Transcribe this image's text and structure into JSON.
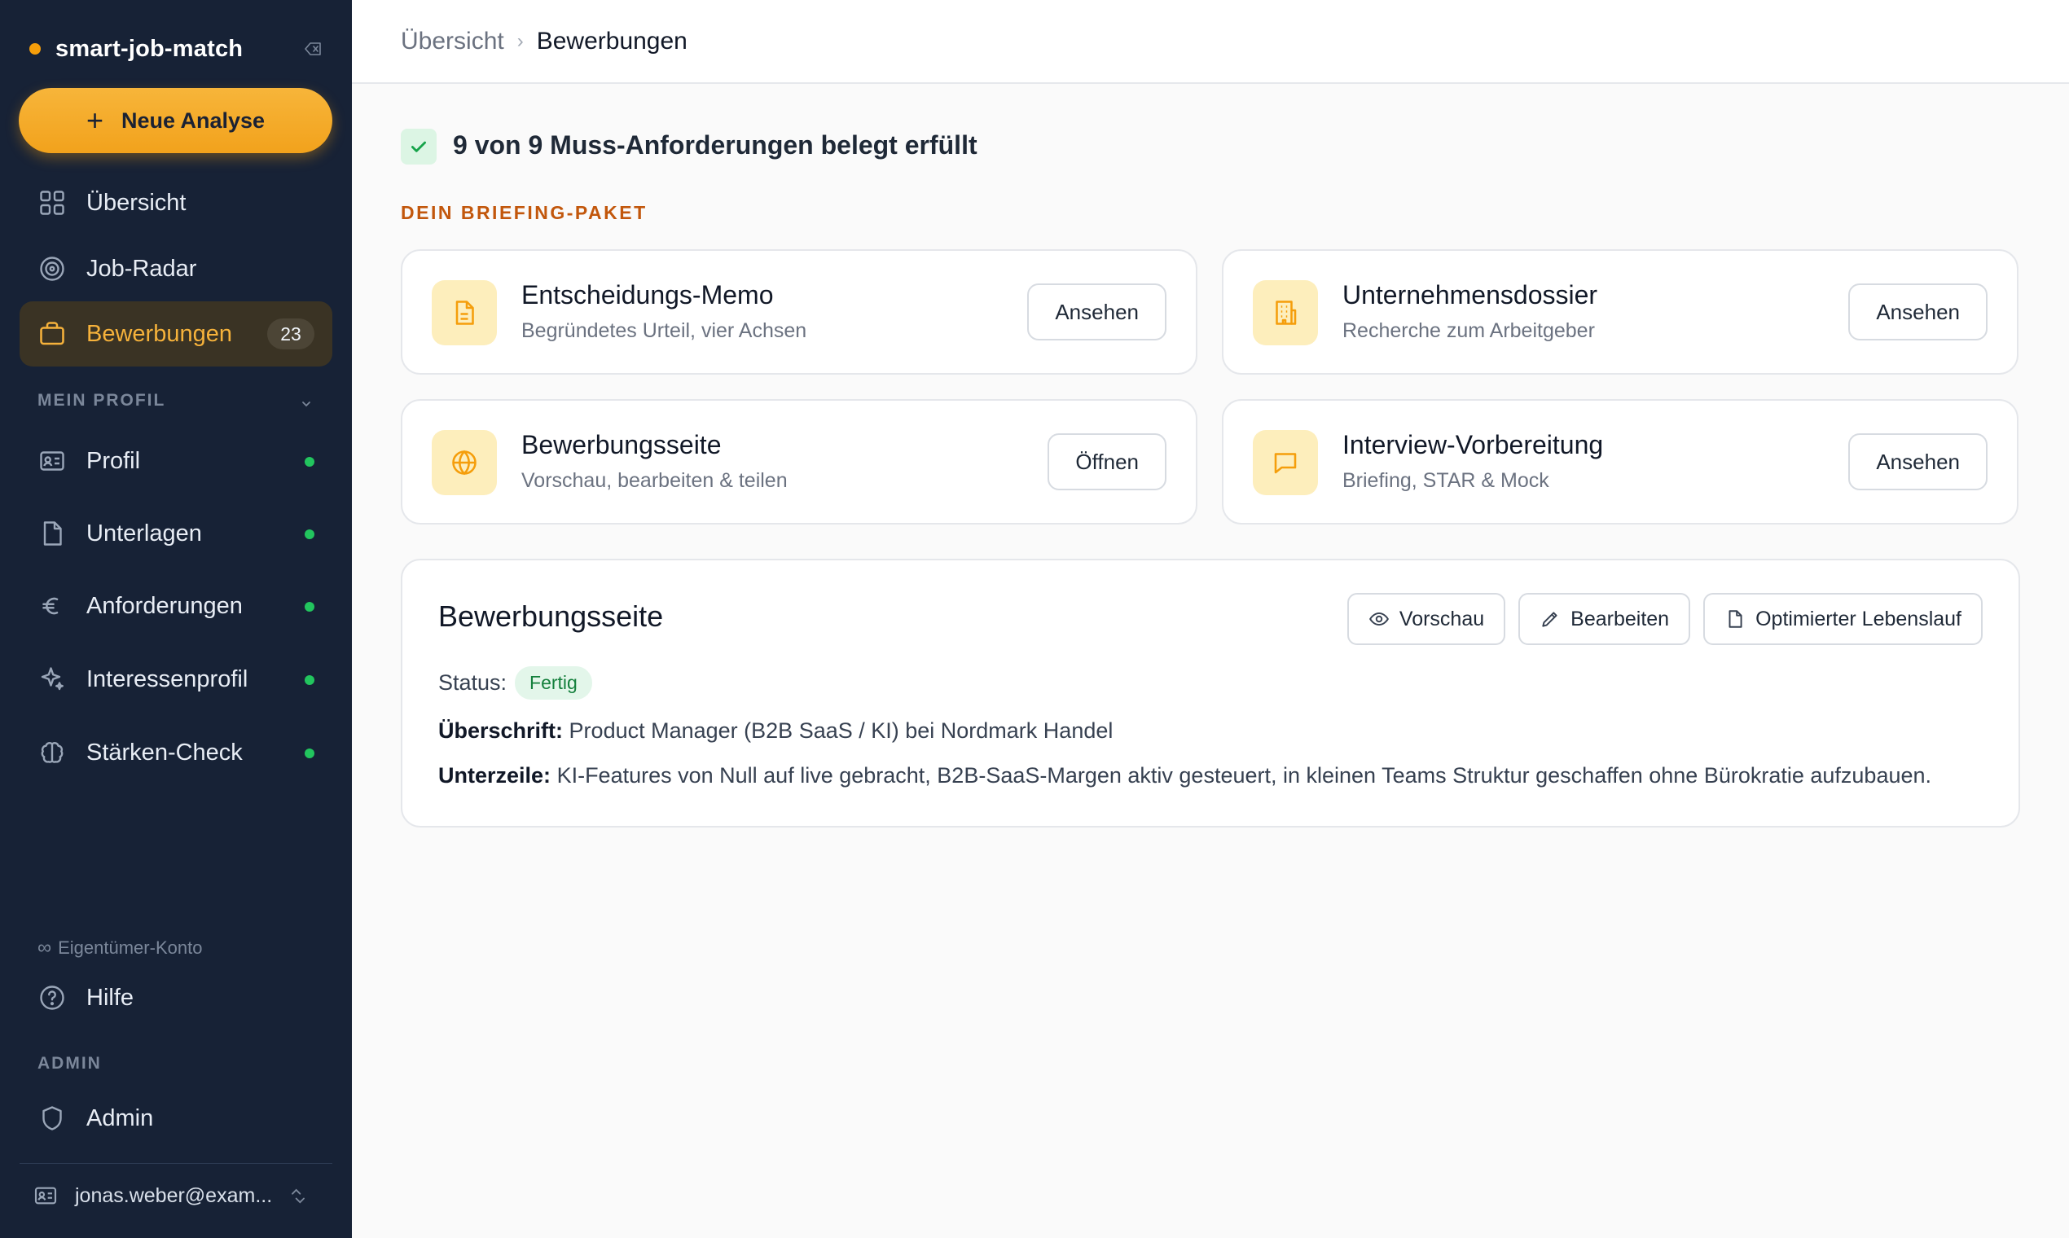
{
  "sidebar": {
    "brand": "smart-job-match",
    "new_button": "Neue Analyse",
    "nav": [
      {
        "label": "Übersicht",
        "icon": "grid-icon"
      },
      {
        "label": "Job-Radar",
        "icon": "radar-icon"
      },
      {
        "label": "Bewerbungen",
        "icon": "briefcase-icon",
        "badge": "23",
        "active": true
      }
    ],
    "section_profile": "MEIN PROFIL",
    "profile_nav": [
      {
        "label": "Profil",
        "icon": "id-card-icon"
      },
      {
        "label": "Unterlagen",
        "icon": "file-icon"
      },
      {
        "label": "Anforderungen",
        "icon": "euro-icon"
      },
      {
        "label": "Interessenprofil",
        "icon": "sparkle-icon"
      },
      {
        "label": "Stärken-Check",
        "icon": "brain-icon"
      }
    ],
    "owner_account": "Eigentümer-Konto",
    "help": "Hilfe",
    "section_admin": "ADMIN",
    "admin": "Admin",
    "user_email": "jonas.weber@exam..."
  },
  "header": {
    "breadcrumb_root": "Übersicht",
    "breadcrumb_separator": "›",
    "breadcrumb_current": "Bewerbungen"
  },
  "main": {
    "requirements_text": "9 von 9 Muss-Anforderungen belegt erfüllt",
    "briefing_label": "DEIN BRIEFING-PAKET",
    "cards": [
      {
        "title": "Entscheidungs-Memo",
        "subtitle": "Begründetes Urteil, vier Achsen",
        "button": "Ansehen",
        "icon": "document-icon"
      },
      {
        "title": "Unternehmensdossier",
        "subtitle": "Recherche zum Arbeitgeber",
        "button": "Ansehen",
        "icon": "building-icon"
      },
      {
        "title": "Bewerbungsseite",
        "subtitle": "Vorschau, bearbeiten & teilen",
        "button": "Öffnen",
        "icon": "globe-icon"
      },
      {
        "title": "Interview-Vorbereitung",
        "subtitle": "Briefing, STAR & Mock",
        "button": "Ansehen",
        "icon": "chat-icon"
      }
    ],
    "panel": {
      "title": "Bewerbungsseite",
      "buttons": {
        "preview": "Vorschau",
        "edit": "Bearbeiten",
        "cv": "Optimierter Lebenslauf"
      },
      "status_label": "Status:",
      "status_value": "Fertig",
      "headline_label": "Überschrift:",
      "headline_value": "Product Manager (B2B SaaS / KI) bei Nordmark Handel",
      "subline_label": "Unterzeile:",
      "subline_value": "KI-Features von Null auf live gebracht, B2B-SaaS-Margen aktiv gesteuert, in kleinen Teams Struktur geschaffen ohne Bürokratie aufzubauen."
    }
  },
  "colors": {
    "sidebar_bg": "#172236",
    "accent": "#f59e0b",
    "active_text": "#f6b23b",
    "status_ok": "#22c55e",
    "section_label": "#c2570c"
  }
}
